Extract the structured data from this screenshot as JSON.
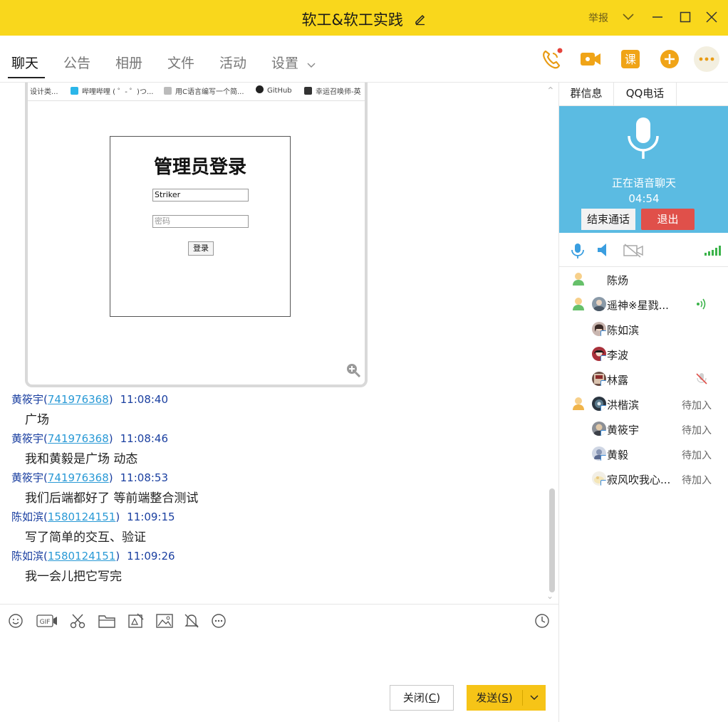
{
  "window": {
    "title": "软工&软工实践",
    "report_label": "举报"
  },
  "tabs": [
    {
      "label": "聊天",
      "active": true
    },
    {
      "label": "公告"
    },
    {
      "label": "相册"
    },
    {
      "label": "文件"
    },
    {
      "label": "活动"
    },
    {
      "label": "设置"
    }
  ],
  "header_icons": [
    "phone-call-icon",
    "video-call-icon",
    "course-icon",
    "add-icon",
    "more-icon"
  ],
  "header_course_label": "课",
  "screenshot": {
    "bookmarks": [
      "设计类...",
      "哔哩哔哩 ( ゜- ゜)つ...",
      "用C语言编写一个简...",
      "GitHub",
      "幸运召唤师-英"
    ],
    "login": {
      "title": "管理员登录",
      "username_value": "Striker",
      "password_placeholder": "密码",
      "submit_label": "登录"
    }
  },
  "messages": [
    {
      "sender": "黄筱宇",
      "qq": "741976368",
      "time": "11:08:40",
      "text": "广场"
    },
    {
      "sender": "黄筱宇",
      "qq": "741976368",
      "time": "11:08:46",
      "text": "我和黄毅是广场 动态"
    },
    {
      "sender": "黄筱宇",
      "qq": "741976368",
      "time": "11:08:53",
      "text": "我们后端都好了  等前端整合测试"
    },
    {
      "sender": "陈如滨",
      "qq": "1580124151",
      "time": "11:09:15",
      "text": "写了简单的交互、验证"
    },
    {
      "sender": "陈如滨",
      "qq": "1580124151",
      "time": "11:09:26",
      "text": "我一会儿把它写完"
    }
  ],
  "input_toolbar": [
    "emoji-icon",
    "gif-icon",
    "scissors-icon",
    "folder-icon",
    "image-edit-icon",
    "image-icon",
    "bell-off-icon",
    "more-circle-icon",
    "history-clock-icon"
  ],
  "input_toolbar_gif_label": "GIF",
  "buttons": {
    "close_pre": "关闭(",
    "close_key": "C",
    "close_post": ")",
    "send_pre": "发送(",
    "send_key": "S",
    "send_post": ")"
  },
  "right_panel": {
    "tabs": [
      "群信息",
      "QQ电话"
    ],
    "voice": {
      "status": "正在语音聊天",
      "timer": "04:54",
      "end_label": "结束通话",
      "exit_label": "退出"
    },
    "members": [
      {
        "name": "陈炀",
        "admin": true,
        "avatar": false,
        "state": ""
      },
      {
        "name": "遥神※星戮...",
        "admin": true,
        "avatar": true,
        "speaking": true,
        "state": ""
      },
      {
        "name": "陈如滨",
        "admin": false,
        "avatar": true,
        "state": ""
      },
      {
        "name": "李波",
        "admin": false,
        "avatar": true,
        "state": ""
      },
      {
        "name": "林露",
        "admin": false,
        "avatar": true,
        "muted": true,
        "state": ""
      },
      {
        "name": "洪楷滨",
        "admin": true,
        "avatar": true,
        "state": "待加入"
      },
      {
        "name": "黄筱宇",
        "admin": false,
        "avatar": true,
        "state": "待加入"
      },
      {
        "name": "黄毅",
        "admin": false,
        "avatar": true,
        "state": "待加入"
      },
      {
        "name": "寂风吹我心...",
        "admin": false,
        "avatar": true,
        "state": "待加入"
      }
    ]
  },
  "colors": {
    "accent_yellow": "#f9d71c",
    "voice_blue": "#5bbbe2",
    "exit_red": "#e0504a",
    "link_blue": "#2a9ad6"
  }
}
